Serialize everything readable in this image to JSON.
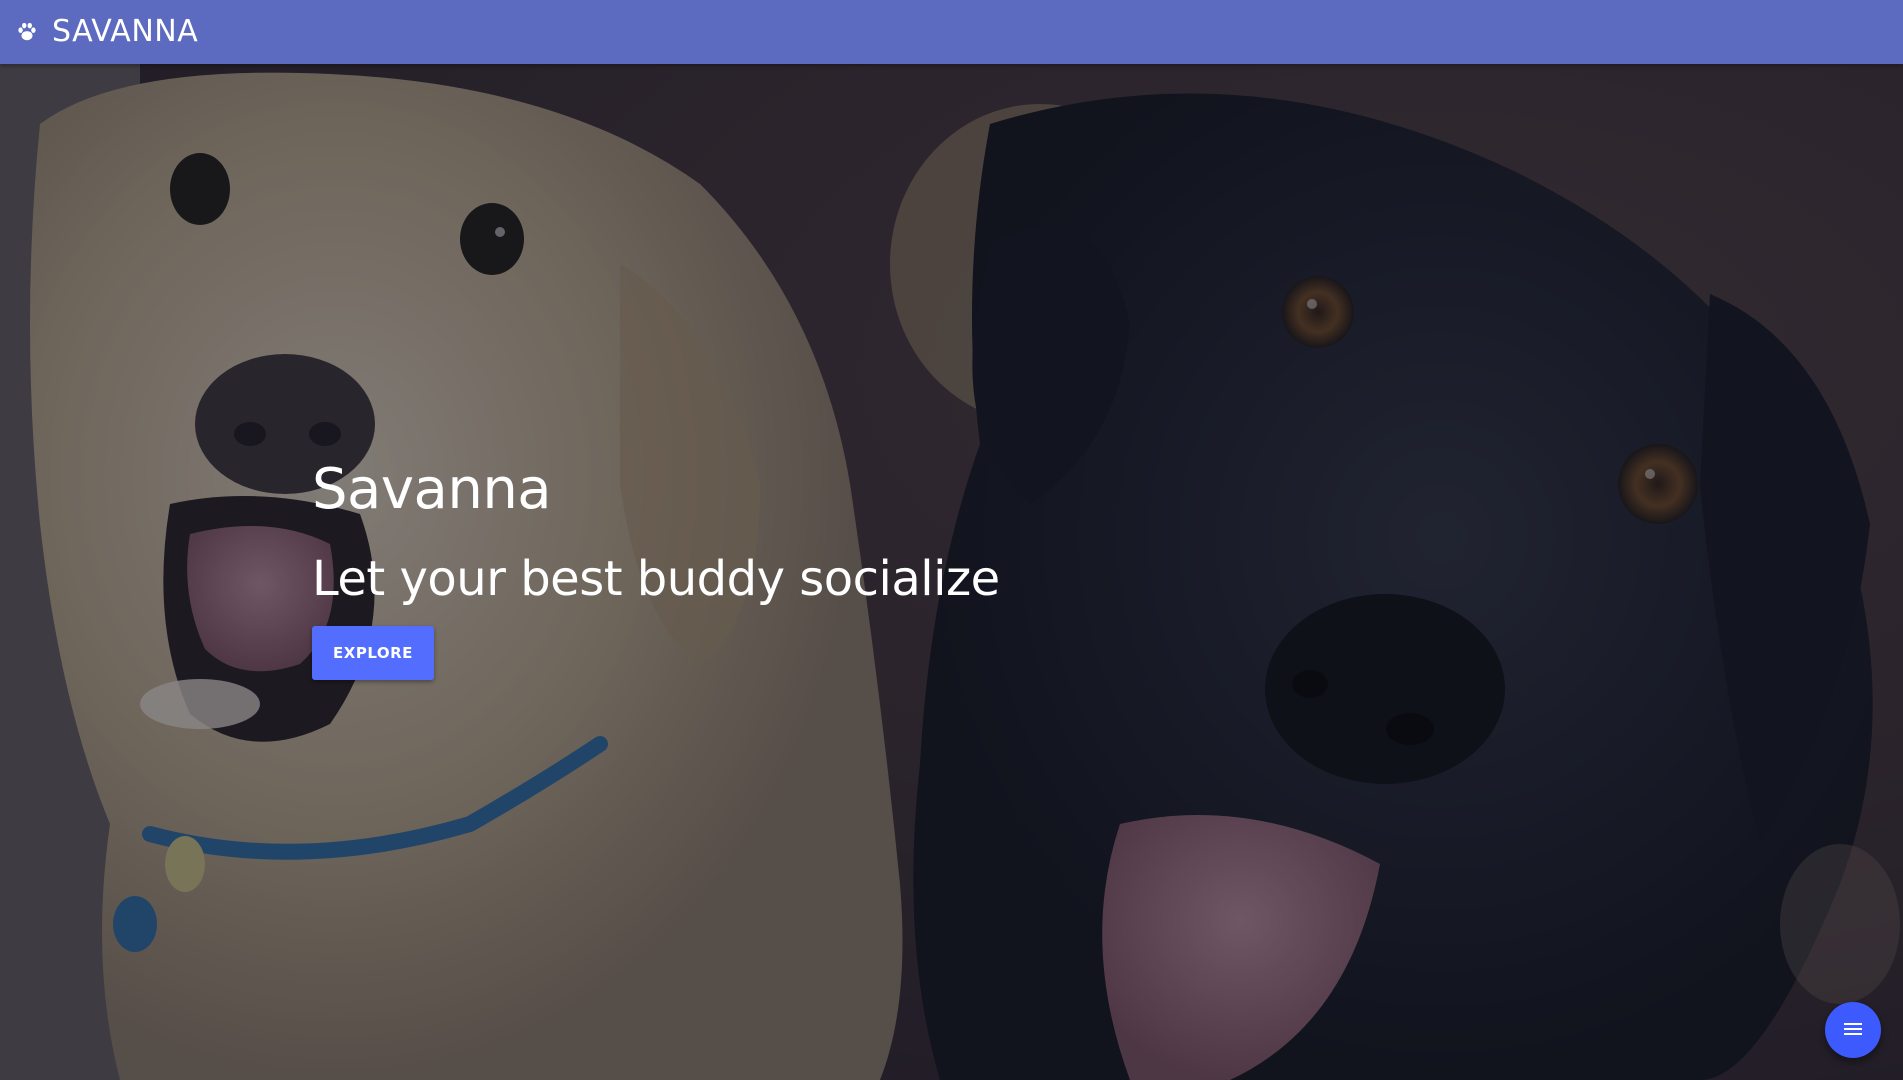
{
  "appbar": {
    "brand": "SAVANNA",
    "logo_icon": "paw-icon",
    "background_color": "#5c6bc0"
  },
  "hero": {
    "title": "Savanna",
    "subtitle": "Let your best buddy socialize",
    "explore_label": "EXPLORE",
    "button_color": "#536dfe",
    "background_image": "two-dogs-photo"
  },
  "fab": {
    "icon": "menu-icon",
    "color": "#3d5afe"
  }
}
